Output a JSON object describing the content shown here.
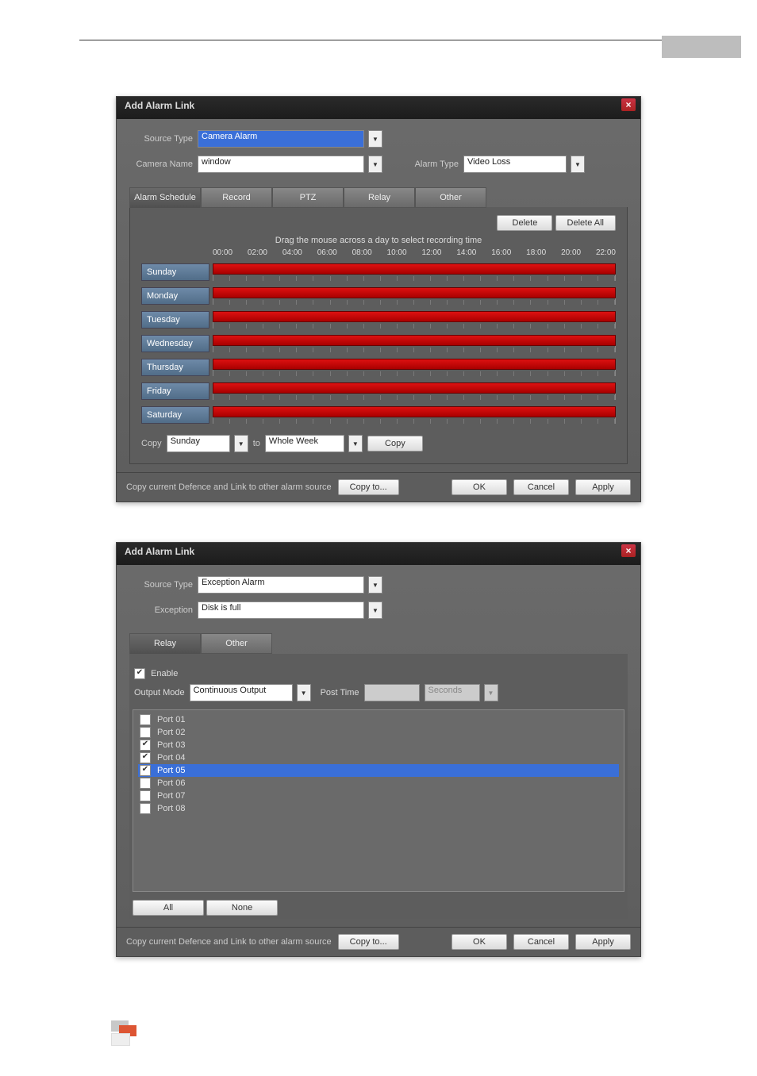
{
  "dialog_title": "Add Alarm Link",
  "labels": {
    "source_type": "Source Type",
    "camera_name": "Camera Name",
    "alarm_type": "Alarm Type",
    "exception": "Exception",
    "enable": "Enable",
    "output_mode": "Output Mode",
    "post_time": "Post Time",
    "copy": "Copy",
    "to": "to"
  },
  "values": {
    "source_type_1": "Camera Alarm",
    "camera_name": "window",
    "alarm_type": "Video Loss",
    "source_type_2": "Exception Alarm",
    "exception": "Disk is full",
    "output_mode": "Continuous Output",
    "post_time": "",
    "seconds": "Seconds",
    "copy_from": "Sunday",
    "copy_to": "Whole Week"
  },
  "tabs1": [
    "Alarm Schedule",
    "Record",
    "PTZ",
    "Relay",
    "Other"
  ],
  "tabs2": [
    "Relay",
    "Other"
  ],
  "buttons": {
    "delete": "Delete",
    "delete_all": "Delete All",
    "copy": "Copy",
    "copy_to": "Copy to...",
    "ok": "OK",
    "cancel": "Cancel",
    "apply": "Apply",
    "all": "All",
    "none": "None"
  },
  "schedule": {
    "hint": "Drag the mouse across a day to select recording time",
    "hours": [
      "00:00",
      "02:00",
      "04:00",
      "06:00",
      "08:00",
      "10:00",
      "12:00",
      "14:00",
      "16:00",
      "18:00",
      "20:00",
      "22:00"
    ],
    "days": [
      "Sunday",
      "Monday",
      "Tuesday",
      "Wednesday",
      "Thursday",
      "Friday",
      "Saturday"
    ]
  },
  "footer_text": "Copy current Defence and Link to other alarm source",
  "ports": [
    {
      "label": "Port 01",
      "checked": false,
      "selected": false
    },
    {
      "label": "Port 02",
      "checked": false,
      "selected": false
    },
    {
      "label": "Port 03",
      "checked": true,
      "selected": false
    },
    {
      "label": "Port 04",
      "checked": true,
      "selected": false
    },
    {
      "label": "Port 05",
      "checked": true,
      "selected": true
    },
    {
      "label": "Port 06",
      "checked": false,
      "selected": false
    },
    {
      "label": "Port 07",
      "checked": false,
      "selected": false
    },
    {
      "label": "Port 08",
      "checked": false,
      "selected": false
    }
  ]
}
